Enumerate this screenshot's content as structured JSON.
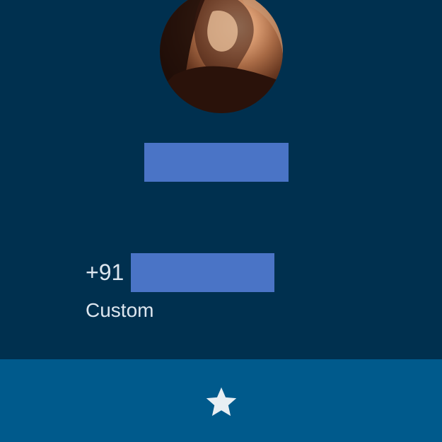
{
  "contact": {
    "phone_prefix": "+91",
    "phone_type": "Custom"
  },
  "actions": {
    "favorite_icon": "star-icon"
  },
  "colors": {
    "background": "#00304f",
    "bottom_bar": "#005a8c",
    "redaction": "#4a74c6",
    "text": "#dde6ef"
  }
}
